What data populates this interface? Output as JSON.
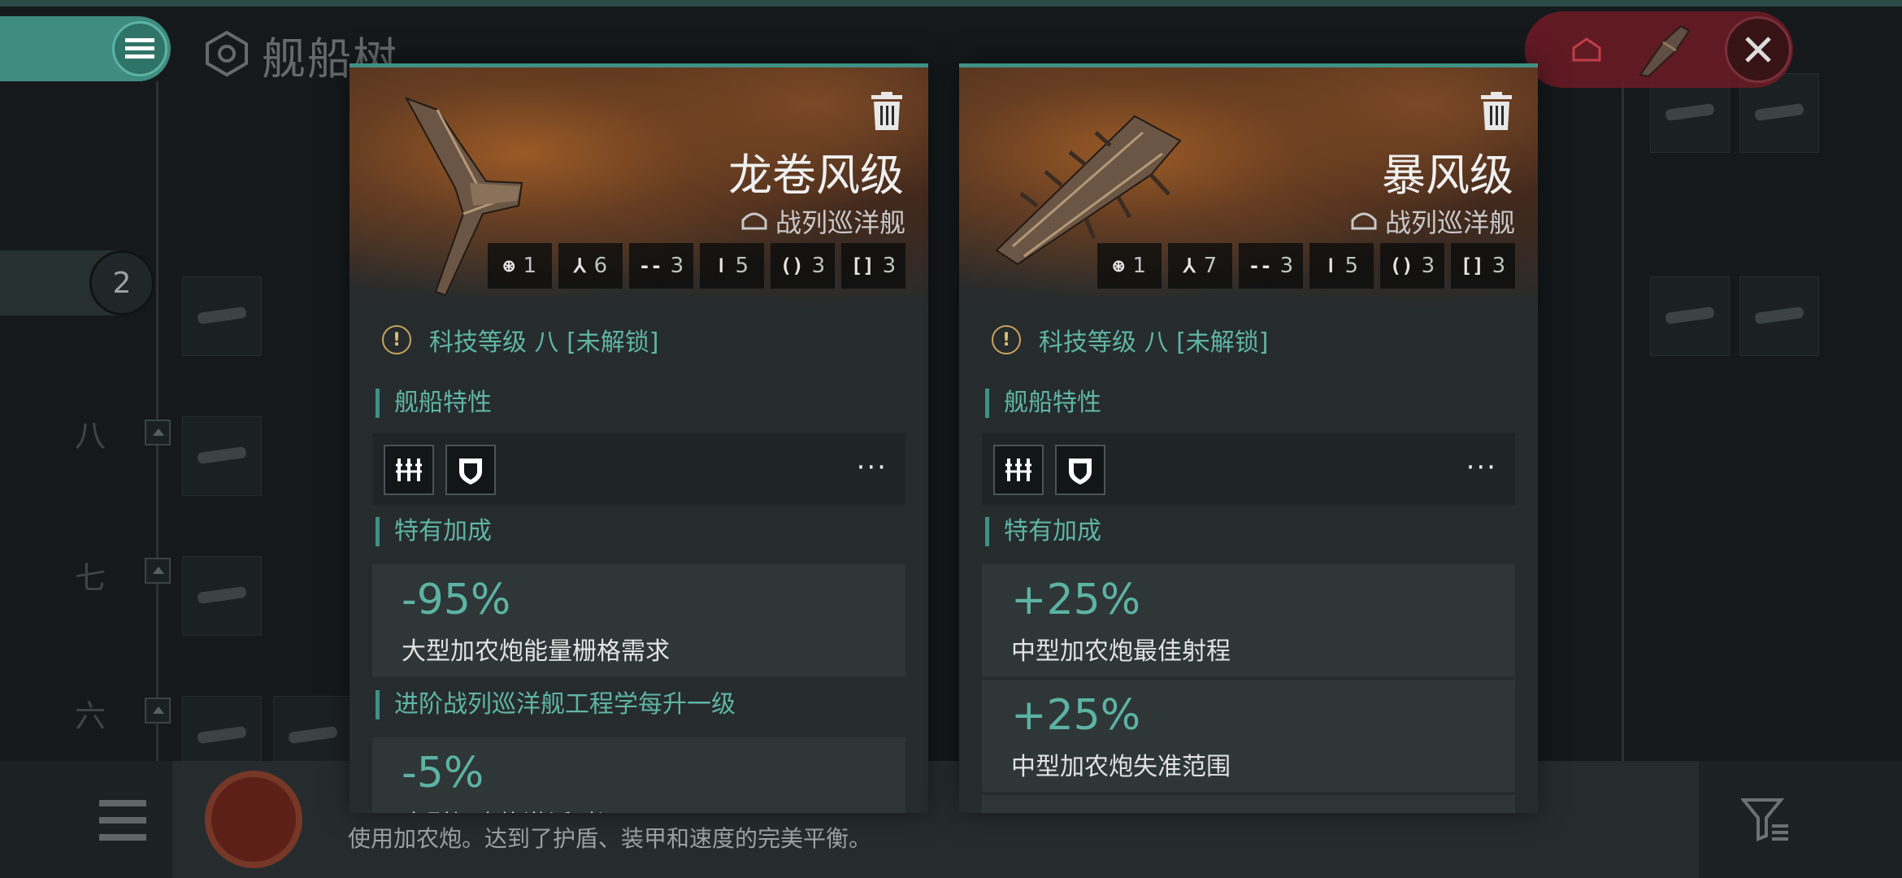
{
  "page": {
    "title": "舰船树",
    "tier_badge": "2",
    "tier_labels": [
      "八",
      "七",
      "六"
    ],
    "bottom_description": "使用加农炮。达到了护盾、装甲和速度的完美平衡。"
  },
  "colors": {
    "accent": "#3f9186",
    "accent_text": "#5fb5a5",
    "warning": "#c9a45a",
    "danger_pill": "#6e1b24",
    "panel": "#262c2e"
  },
  "cards": [
    {
      "name": "龙卷风级",
      "class": "战列巡洋舰",
      "slots": [
        {
          "icon": "drone-bay-icon",
          "value": "1"
        },
        {
          "icon": "turret-hardpoint-icon",
          "value": "6"
        },
        {
          "icon": "high-slot-icon",
          "value": "3"
        },
        {
          "icon": "mid-slot-icon",
          "value": "5"
        },
        {
          "icon": "low-slot-icon",
          "value": "3"
        },
        {
          "icon": "rig-slot-icon",
          "value": "3"
        }
      ],
      "tech": "科技等级 八 [未解锁]",
      "traits_title": "舰船特性",
      "traits_more": "···",
      "bonus_title": "特有加成",
      "bonuses": [
        {
          "value": "-95%",
          "desc": "大型加农炮能量栅格需求"
        }
      ],
      "skill_title": "进阶战列巡洋舰工程学每升一级",
      "skill_bonuses": [
        {
          "value": "-5%",
          "desc": "大型加农炮激活时间"
        }
      ]
    },
    {
      "name": "暴风级",
      "class": "战列巡洋舰",
      "slots": [
        {
          "icon": "drone-bay-icon",
          "value": "1"
        },
        {
          "icon": "turret-hardpoint-icon",
          "value": "7"
        },
        {
          "icon": "high-slot-icon",
          "value": "3"
        },
        {
          "icon": "mid-slot-icon",
          "value": "5"
        },
        {
          "icon": "low-slot-icon",
          "value": "3"
        },
        {
          "icon": "rig-slot-icon",
          "value": "3"
        }
      ],
      "tech": "科技等级 八 [未解锁]",
      "traits_title": "舰船特性",
      "traits_more": "···",
      "bonus_title": "特有加成",
      "bonuses": [
        {
          "value": "+25%",
          "desc": "中型加农炮最佳射程"
        },
        {
          "value": "+25%",
          "desc": "中型加农炮失准范围"
        }
      ]
    }
  ]
}
